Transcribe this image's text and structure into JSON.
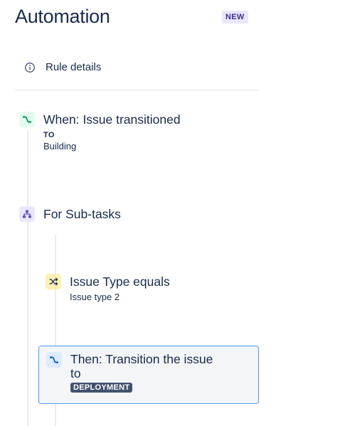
{
  "header": {
    "title": "Automation",
    "badge": "NEW"
  },
  "rule_details": {
    "label": "Rule details",
    "icon": "info-icon"
  },
  "trigger": {
    "title": "When: Issue transitioned",
    "to_label": "TO",
    "value": "Building",
    "icon": "transition-icon"
  },
  "branch": {
    "title": "For Sub-tasks",
    "icon": "hierarchy-icon"
  },
  "condition": {
    "title": "Issue Type equals",
    "value": "Issue type 2",
    "icon": "shuffle-icon"
  },
  "action": {
    "title_line1": "Then: Transition the issue",
    "title_line2": "to",
    "status": "DEPLOYMENT",
    "icon": "transition-icon"
  },
  "colors": {
    "text": "#172B4D",
    "selected_border": "#4C9AFF",
    "trigger_green": "#00875A",
    "branch_purple": "#6554C0",
    "condition_yellow": "#FF8B00",
    "action_blue": "#0052CC",
    "status_lozenge": "#42526E"
  }
}
